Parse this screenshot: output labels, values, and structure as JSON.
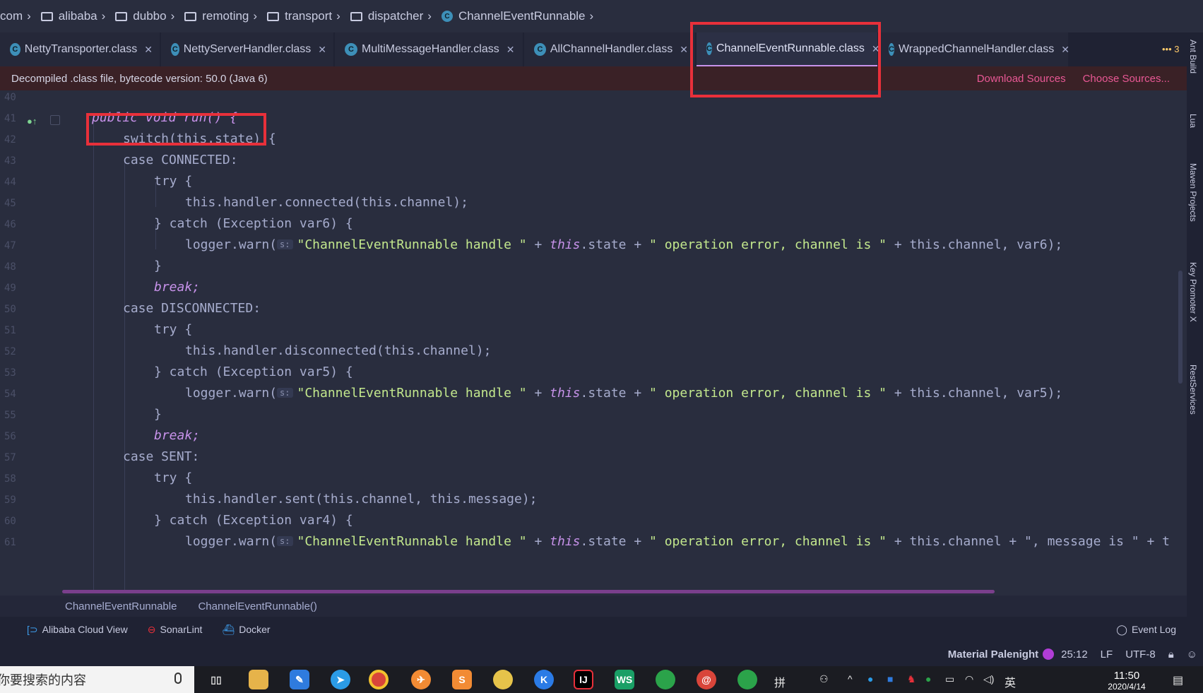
{
  "breadcrumb": {
    "items": [
      "com",
      "alibaba",
      "dubbo",
      "remoting",
      "transport",
      "dispatcher",
      "ChannelEventRunnable"
    ]
  },
  "tabs": [
    {
      "label": "NettyTransporter.class"
    },
    {
      "label": "NettyServerHandler.class"
    },
    {
      "label": "MultiMessageHandler.class"
    },
    {
      "label": "AllChannelHandler.class"
    },
    {
      "label": "ChannelEventRunnable.class",
      "active": true
    },
    {
      "label": "WrappedChannelHandler.class"
    }
  ],
  "tabs_more": "3",
  "banner": {
    "text": "Decompiled .class file, bytecode version: 50.0 (Java 6)",
    "download_sources": "Download Sources",
    "choose_sources": "Choose Sources..."
  },
  "line_numbers": [
    "40",
    "41",
    "42",
    "43",
    "44",
    "45",
    "46",
    "47",
    "48",
    "49",
    "50",
    "51",
    "52",
    "53",
    "54",
    "55",
    "56",
    "57",
    "58",
    "59",
    "60",
    "61"
  ],
  "code": {
    "l41": "public void run() {",
    "l42": "switch(this.state) {",
    "l43": "case CONNECTED:",
    "l44": "try {",
    "l45": "this.handler.connected(this.channel);",
    "l46": "} catch (Exception var6) {",
    "hint": "s:",
    "log_string": "\"ChannelEventRunnable handle \"",
    "op_string": "\" operation error, channel is \"",
    "l47_tail": "this.channel, var6);",
    "close": "}",
    "brk": "break;",
    "l50": "case DISCONNECTED:",
    "l52": "this.handler.disconnected(this.channel);",
    "l53": "} catch (Exception var5) {",
    "l54_tail": "this.channel, var5);",
    "l57": "case SENT:",
    "l59": "this.handler.sent(this.channel, this.message);",
    "l60": "} catch (Exception var4) {",
    "l61_tail": "this.channel + \", message is \" + t"
  },
  "code_crumbs": {
    "class": "ChannelEventRunnable",
    "method": "ChannelEventRunnable()"
  },
  "tool_windows": {
    "alibaba": "Alibaba Cloud View",
    "sonarlint": "SonarLint",
    "docker": "Docker",
    "event_log": "Event Log"
  },
  "status": {
    "theme": "Material Palenight",
    "position": "25:12",
    "line_sep": "LF",
    "encoding": "UTF-8"
  },
  "right_sidebar": [
    "Ant Build",
    "Lua",
    "Maven Projects",
    "Key Promoter X",
    "RestServices"
  ],
  "taskbar": {
    "search_placeholder": "你要搜索的内容",
    "ime": "拼",
    "lang": "英",
    "time": "11:50",
    "date": "2020/4/14"
  },
  "colors": {
    "background": "#292d3e",
    "keyword": "#c792ea",
    "string": "#c3e88d",
    "highlight_box": "#e8303a",
    "banner_link": "#e95895"
  }
}
